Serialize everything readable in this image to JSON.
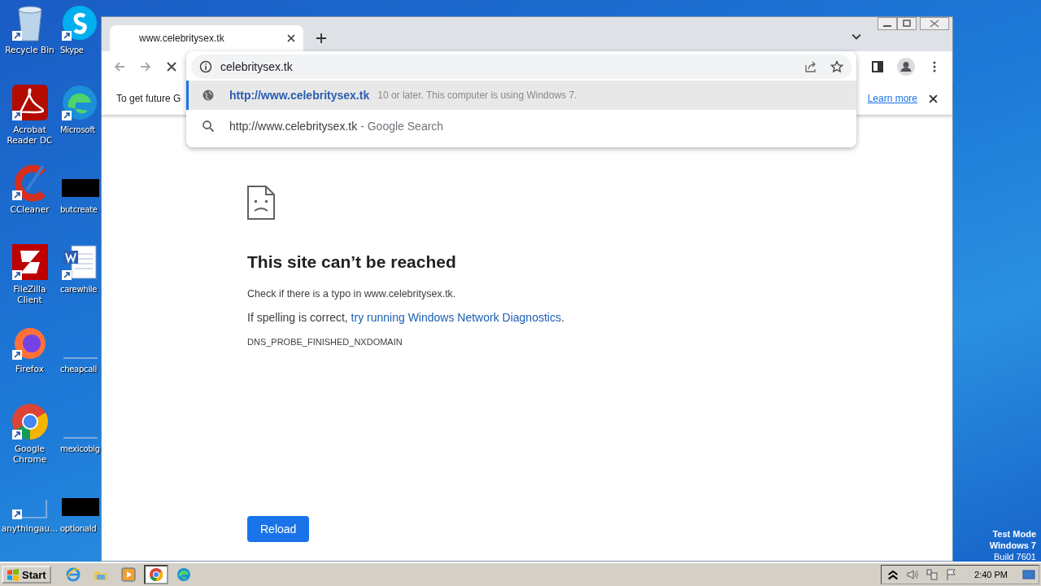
{
  "desktop": {
    "icons_left": [
      {
        "label": "Recycle Bin",
        "kind": "recycle"
      },
      {
        "label": "Acrobat Reader DC",
        "kind": "acrobat"
      },
      {
        "label": "CCleaner",
        "kind": "ccleaner"
      },
      {
        "label": "FileZilla Client",
        "kind": "filezilla"
      },
      {
        "label": "Firefox",
        "kind": "firefox"
      },
      {
        "label": "Google Chrome",
        "kind": "chrome"
      },
      {
        "label": "anythingau...",
        "kind": "line"
      }
    ],
    "icons_right": [
      {
        "label": "Skype",
        "kind": "skype"
      },
      {
        "label": "Microsoft",
        "kind": "edge"
      },
      {
        "label": "butcreate",
        "kind": "black"
      },
      {
        "label": "carewhile",
        "kind": "word"
      },
      {
        "label": "cheapcall",
        "kind": "line"
      },
      {
        "label": "mexicobig",
        "kind": "line"
      },
      {
        "label": "optionald",
        "kind": "black"
      }
    ],
    "system_text": [
      "Test Mode",
      "Windows 7",
      "Build 7601"
    ]
  },
  "browser": {
    "tab": {
      "title": "www.celebritysex.tk",
      "selected": true
    },
    "omnibox": {
      "value": "celebritysex.tk"
    },
    "suggestions": [
      {
        "kind": "url",
        "text": "http://www.celebritysex.tk",
        "selected": true
      },
      {
        "kind": "search",
        "text": "http://www.celebritysex.tk",
        "suffix": "- Google Search",
        "selected": false
      }
    ],
    "infobar": {
      "text": "To get future G",
      "shown_through": "10 or later. This computer is using Windows 7.",
      "link": "Learn more"
    },
    "error": {
      "title": "This site can’t be reached",
      "line1": "Check if there is a typo in www.celebritysex.tk.",
      "line2_prefix": "If spelling is correct,",
      "line2_link": "try running Windows Network Diagnostics",
      "line2_suffix": ".",
      "code": "DNS_PROBE_FINISHED_NXDOMAIN",
      "button": "Reload"
    }
  },
  "taskbar": {
    "start": "Start",
    "apps": [
      {
        "kind": "ie",
        "selected": false
      },
      {
        "kind": "explorer",
        "selected": false
      },
      {
        "kind": "media",
        "selected": false
      },
      {
        "kind": "chrome",
        "selected": true
      },
      {
        "kind": "edge",
        "selected": false
      }
    ],
    "clock": "2:40 PM"
  }
}
